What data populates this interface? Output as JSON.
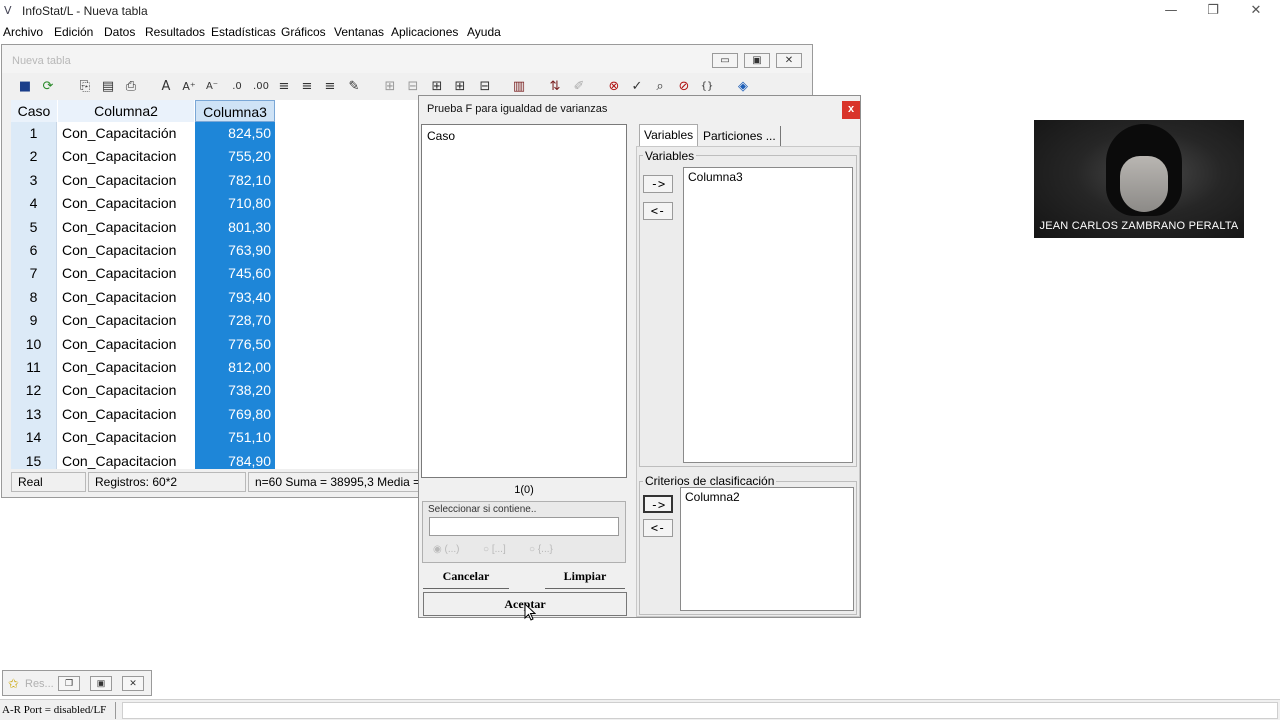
{
  "app": {
    "title": "InfoStat/L - Nueva tabla",
    "icon": "infostat-logo-icon",
    "window_controls": {
      "minimize": "—",
      "restore": "❐",
      "close": "✕"
    }
  },
  "menu": [
    "Archivo",
    "Edición",
    "Datos",
    "Resultados",
    "Estadísticas",
    "Gráficos",
    "Ventanas",
    "Aplicaciones",
    "Ayuda"
  ],
  "table_window": {
    "title": "Nueva tabla",
    "columns": [
      "Caso",
      "Columna2",
      "Columna3"
    ],
    "rows": [
      {
        "caso": "1",
        "col2": "Con_Capacitación",
        "col3": "824,50"
      },
      {
        "caso": "2",
        "col2": "Con_Capacitacion",
        "col3": "755,20"
      },
      {
        "caso": "3",
        "col2": "Con_Capacitacion",
        "col3": "782,10"
      },
      {
        "caso": "4",
        "col2": "Con_Capacitacion",
        "col3": "710,80"
      },
      {
        "caso": "5",
        "col2": "Con_Capacitacion",
        "col3": "801,30"
      },
      {
        "caso": "6",
        "col2": "Con_Capacitacion",
        "col3": "763,90"
      },
      {
        "caso": "7",
        "col2": "Con_Capacitacion",
        "col3": "745,60"
      },
      {
        "caso": "8",
        "col2": "Con_Capacitacion",
        "col3": "793,40"
      },
      {
        "caso": "9",
        "col2": "Con_Capacitacion",
        "col3": "728,70"
      },
      {
        "caso": "10",
        "col2": "Con_Capacitacion",
        "col3": "776,50"
      },
      {
        "caso": "11",
        "col2": "Con_Capacitacion",
        "col3": "812,00"
      },
      {
        "caso": "12",
        "col2": "Con_Capacitacion",
        "col3": "738,20"
      },
      {
        "caso": "13",
        "col2": "Con_Capacitacion",
        "col3": "769,80"
      },
      {
        "caso": "14",
        "col2": "Con_Capacitacion",
        "col3": "751,10"
      },
      {
        "caso": "15",
        "col2": "Con_Capacitacion",
        "col3": "784,90"
      }
    ],
    "status": {
      "mode": "Real",
      "records": "Registros: 60*2",
      "stats": "n=60   Suma = 38995,3   Media ="
    }
  },
  "dialog": {
    "title": "Prueba F para igualdad de varianzas",
    "close": "x",
    "available": [
      "Caso"
    ],
    "count": "1(0)",
    "filter_label": "Seleccionar si contiene..",
    "filter_value": "",
    "radio_options": [
      "(...)",
      "[...]",
      "{...}"
    ],
    "cancel": "Cancelar",
    "clear": "Limpiar",
    "ok": "Aceptar",
    "tabs": [
      "Variables",
      "Particiones ..."
    ],
    "variables_label": "Variables",
    "variables": [
      "Columna3"
    ],
    "criteria_label": "Criterios de clasificación",
    "criteria": [
      "Columna2"
    ],
    "add_arrow": "->",
    "remove_arrow": "<-"
  },
  "webcam": {
    "name": "JEAN CARLOS ZAMBRANO PERALTA"
  },
  "minimized": {
    "title": "Res..."
  },
  "bottom": {
    "port": "A-R Port = disabled/LF"
  }
}
